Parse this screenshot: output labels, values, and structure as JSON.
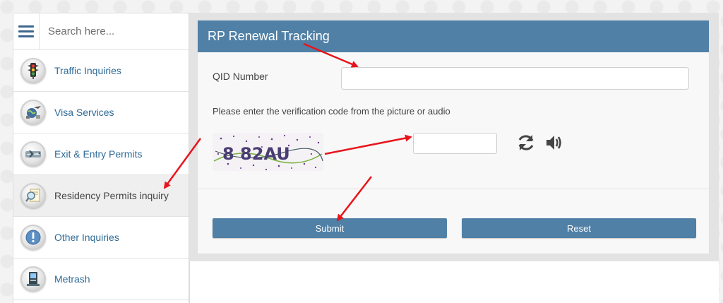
{
  "search": {
    "placeholder": "Search here..."
  },
  "sidebar": {
    "items": [
      {
        "label": "Traffic Inquiries",
        "icon": "traffic-light-icon"
      },
      {
        "label": "Visa Services",
        "icon": "globe-plane-icon"
      },
      {
        "label": "Exit & Entry Permits",
        "icon": "airplane-icon"
      },
      {
        "label": "Residency Permits inquiry",
        "icon": "magnifier-document-icon",
        "active": true
      },
      {
        "label": "Other Inquiries",
        "icon": "exclamation-icon"
      },
      {
        "label": "Metrash",
        "icon": "kiosk-icon"
      }
    ]
  },
  "form": {
    "title": "RP Renewal Tracking",
    "qid_label": "QID Number",
    "qid_value": "",
    "verify_instruction": "Please enter the verification code from the picture or audio",
    "captcha_text": "8 82AU",
    "captcha_value": "",
    "submit_label": "Submit",
    "reset_label": "Reset"
  },
  "colors": {
    "accent": "#5080a6",
    "link": "#2f6b97",
    "arrow": "#e8141b"
  }
}
